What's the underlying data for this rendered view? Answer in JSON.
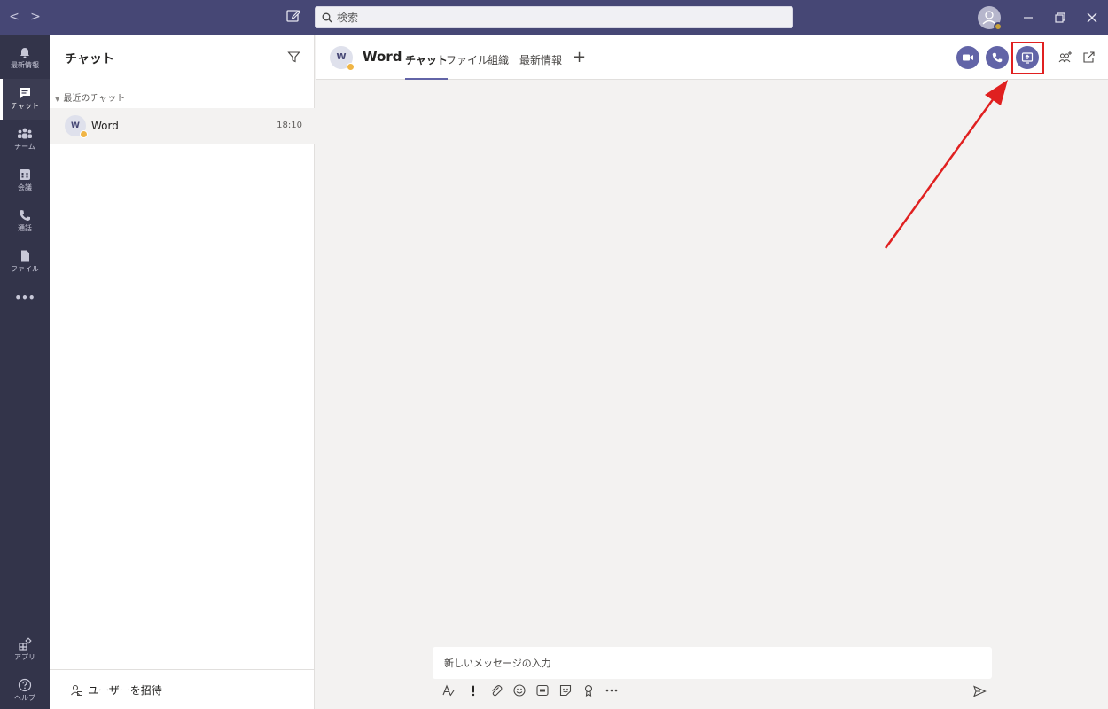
{
  "titlebar": {
    "back": "<",
    "forward": ">",
    "search_placeholder": "検索"
  },
  "rail": {
    "items": [
      {
        "label": "最新情報",
        "icon": "bell-icon"
      },
      {
        "label": "チャット",
        "icon": "chat-icon"
      },
      {
        "label": "チーム",
        "icon": "teams-icon"
      },
      {
        "label": "会議",
        "icon": "calendar-icon"
      },
      {
        "label": "通話",
        "icon": "phone-icon"
      },
      {
        "label": "ファイル",
        "icon": "file-icon"
      },
      {
        "label": "•••",
        "icon": "more-icon"
      }
    ],
    "bottom": [
      {
        "label": "アプリ",
        "icon": "apps-icon"
      },
      {
        "label": "ヘルプ",
        "icon": "help-icon"
      }
    ]
  },
  "chat_list": {
    "title": "チャット",
    "section": "最近のチャット",
    "items": [
      {
        "initial": "W",
        "name": "Word",
        "time": "18:10"
      }
    ],
    "invite": "ユーザーを招待"
  },
  "main": {
    "avatar_initial": "W",
    "title": "Word",
    "tabs": [
      "チャット",
      "ファイル",
      "組織",
      "最新情報"
    ],
    "add_tab": "+",
    "compose_placeholder": "新しいメッセージの入力"
  },
  "colors": {
    "titlebar": "#464775",
    "rail": "#33344a",
    "accent": "#6264a7",
    "highlight": "#e02020"
  }
}
